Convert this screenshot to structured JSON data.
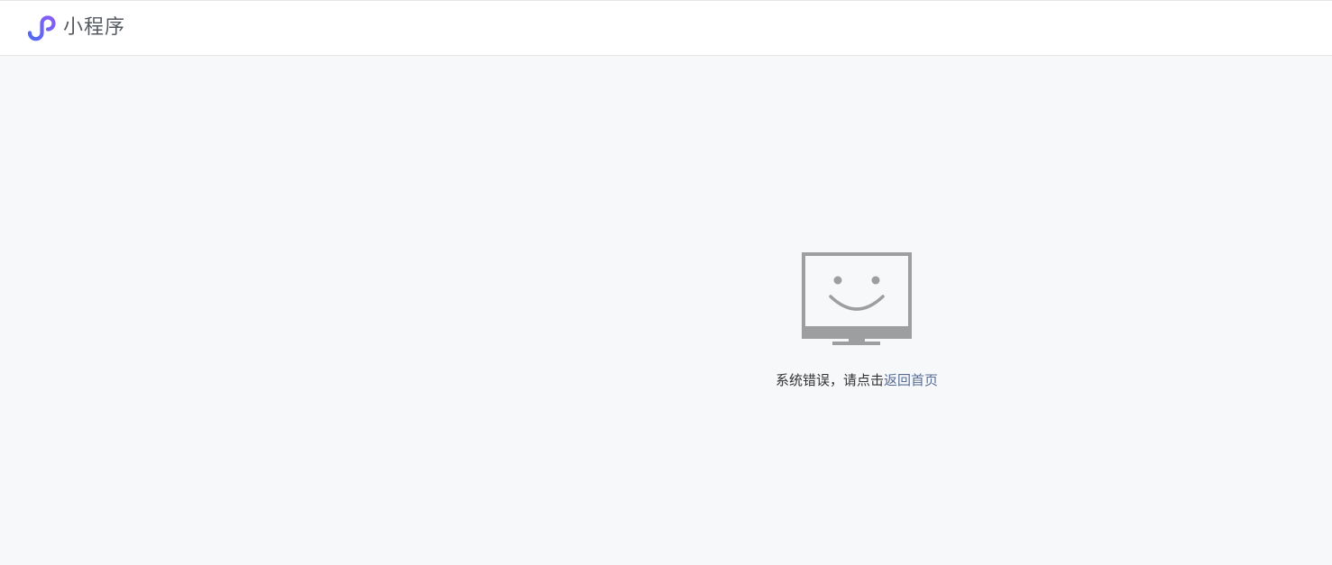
{
  "header": {
    "brand_label": "小程序",
    "logo_icon": "mini-program-logo-icon",
    "brand_color": "#6b68e8"
  },
  "error": {
    "icon": "smiling-monitor-icon",
    "message_prefix": "系统错误，请点击",
    "home_link_label": "返回首页",
    "link_color": "#576b95"
  }
}
